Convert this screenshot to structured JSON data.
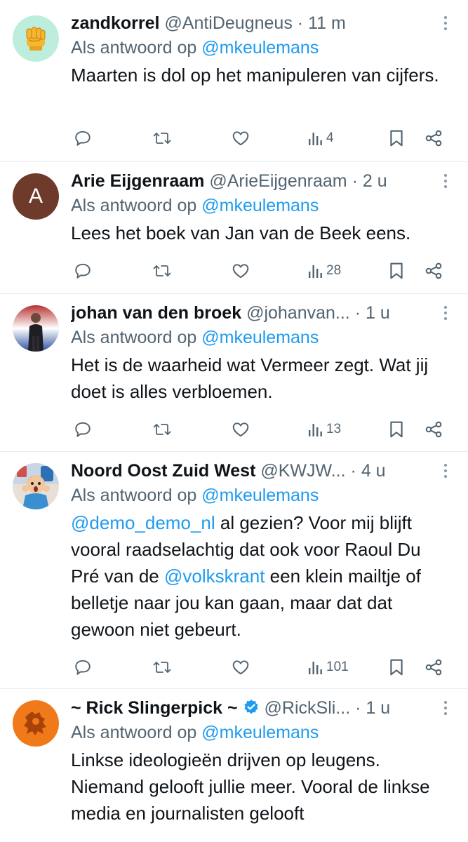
{
  "colors": {
    "text": "#0f1419",
    "muted": "#536471",
    "link": "#1d9bf0",
    "border": "#e6ecf0",
    "verified": "#1d9bf0"
  },
  "tweets": [
    {
      "name": "zandkorrel",
      "handle": "@AntiDeugneus",
      "dot": "·",
      "time": "11 m",
      "reply_prefix": "Als antwoord op",
      "reply_to": "@mkeulemans",
      "text": "Maarten is dol op het manipuleren van cijfers.",
      "views": "4",
      "avatar_icon": "raised-fist-icon"
    },
    {
      "name": "Arie Eijgenraam",
      "handle": "@ArieEijgenraam",
      "dot": "·",
      "time": "2 u",
      "reply_prefix": "Als antwoord op",
      "reply_to": "@mkeulemans",
      "text": "Lees het boek van Jan van de Beek eens.",
      "views": "28",
      "avatar_letter": "A"
    },
    {
      "name": "johan van den broek",
      "handle": "@johanvan...",
      "dot": "·",
      "time": "1 u",
      "reply_prefix": "Als antwoord op",
      "reply_to": "@mkeulemans",
      "text": "Het is de waarheid wat Vermeer zegt. Wat jij doet is alles verbloemen.",
      "views": "13",
      "avatar_icon": "person-photo-icon"
    },
    {
      "name": "Noord Oost Zuid West",
      "handle": "@KWJW...",
      "dot": "·",
      "time": "4 u",
      "reply_prefix": "Als antwoord op",
      "reply_to": "@mkeulemans",
      "text_mention_1": "@demo_demo_nl",
      "text_part_1": " al gezien? Voor mij blijft vooral raadselachtig dat ook voor Raoul Du Pré van de ",
      "text_mention_2": "@volkskrant",
      "text_part_2": " een klein mailtje of belletje naar jou kan gaan, maar dat dat gewoon niet gebeurt.",
      "views": "101",
      "avatar_icon": "cartoon-avatar-icon"
    },
    {
      "name": "~ Rick Slingerpick ~",
      "handle": "@RickSli...",
      "dot": "·",
      "time": "1 u",
      "reply_prefix": "Als antwoord op",
      "reply_to": "@mkeulemans",
      "text": "Linkse ideologieën drijven op leugens. Niemand gelooft jullie meer. Vooral de linkse media en journalisten gelooft",
      "verified_icon": "verified-badge-icon",
      "avatar_icon": "dutch-lion-icon"
    }
  ]
}
